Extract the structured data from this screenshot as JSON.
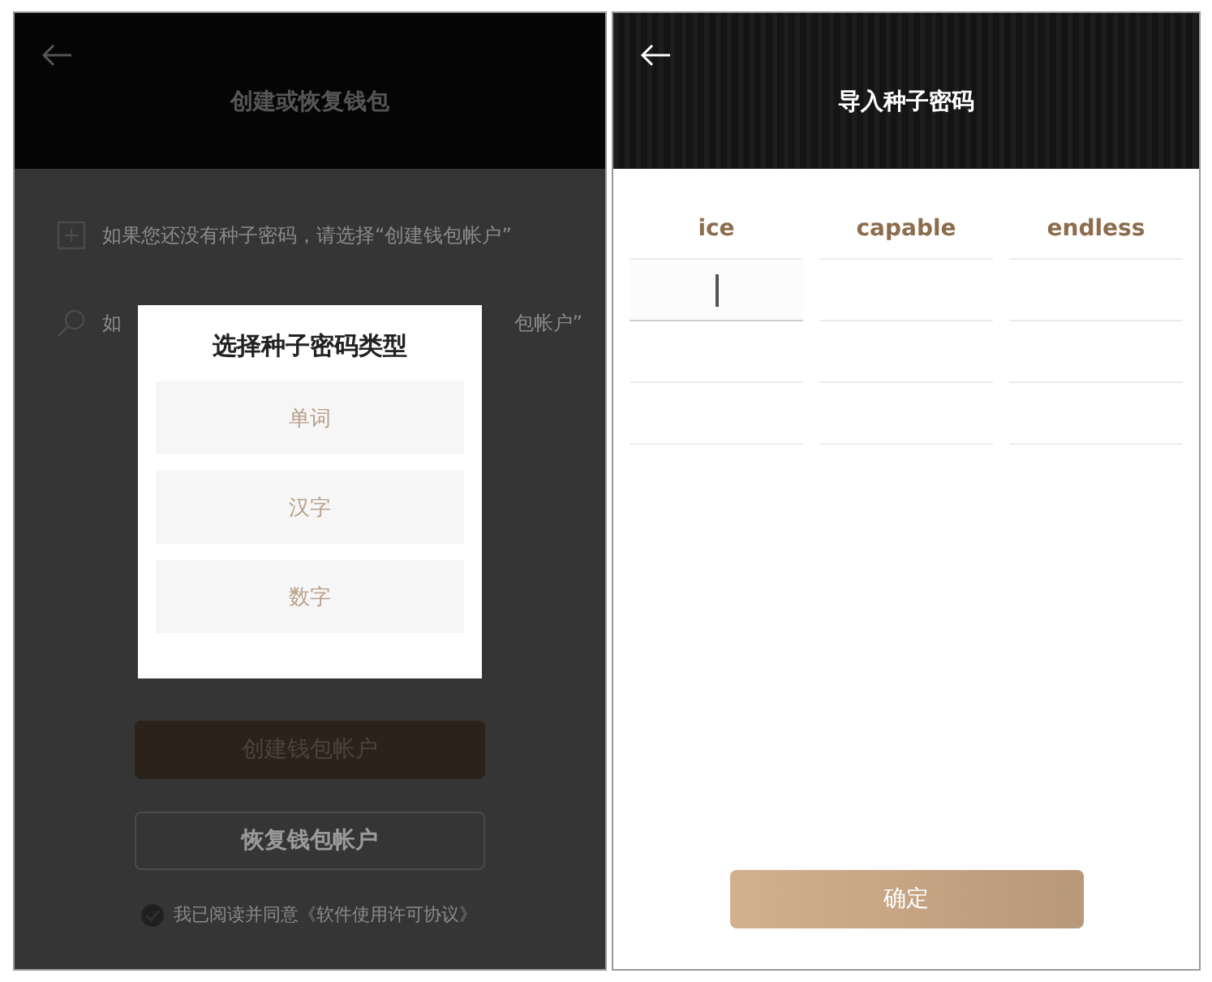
{
  "left_screen": {
    "title": "创建或恢复钱包",
    "info_rows": [
      {
        "kind": "add",
        "text": "如果您还没有种子密码，请选择“创建钱包帐户”"
      },
      {
        "kind": "search",
        "text": "如",
        "text_end": "包帐户”"
      }
    ],
    "dialog": {
      "title": "选择种子密码类型",
      "options": [
        "单词",
        "汉字",
        "数字"
      ]
    },
    "buttons": [
      {
        "kind": "filled",
        "label": "创建钱包帐户"
      },
      {
        "kind": "outline",
        "label": "恢复钱包帐户"
      }
    ],
    "agreement": {
      "checked": true,
      "text": "我已阅读并同意《软件使用许可协议》"
    }
  },
  "right_screen": {
    "title": "导入种子密码",
    "fields": [
      {
        "value": "ice",
        "focused": false
      },
      {
        "value": "capable",
        "focused": false
      },
      {
        "value": "endless",
        "focused": false
      },
      {
        "focused": true
      },
      {
        "focused": false
      },
      {
        "focused": false
      },
      {
        "focused": false
      },
      {
        "focused": false
      },
      {
        "focused": false
      },
      {
        "focused": false
      },
      {
        "focused": false
      },
      {
        "focused": false
      }
    ],
    "confirm_button": "确定"
  }
}
